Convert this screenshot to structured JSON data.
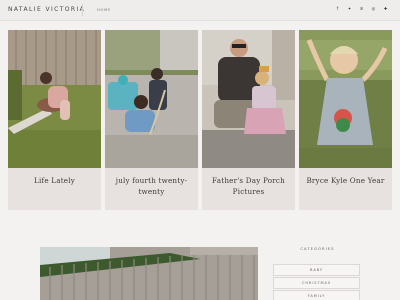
{
  "header": {
    "brand": "NATALIE VICTORIA",
    "nav": {
      "home": "HOME"
    },
    "social": [
      {
        "icon": "facebook-icon",
        "glyph": "f"
      },
      {
        "icon": "twitter-icon",
        "glyph": "✦"
      },
      {
        "icon": "pinterest-icon",
        "glyph": "℗"
      },
      {
        "icon": "instagram-icon",
        "glyph": "◎"
      },
      {
        "icon": "bloglovin-icon",
        "glyph": "✚"
      }
    ]
  },
  "posts": [
    {
      "title": "Life Lately"
    },
    {
      "title": "july fourth twenty-twenty"
    },
    {
      "title": "Father's Day Porch Pictures"
    },
    {
      "title": "Bryce Kyle One Year"
    }
  ],
  "sidebar": {
    "categories_title": "CATEGORIES",
    "categories": [
      "BABY",
      "CHRISTMAS",
      "FAMILY"
    ]
  }
}
